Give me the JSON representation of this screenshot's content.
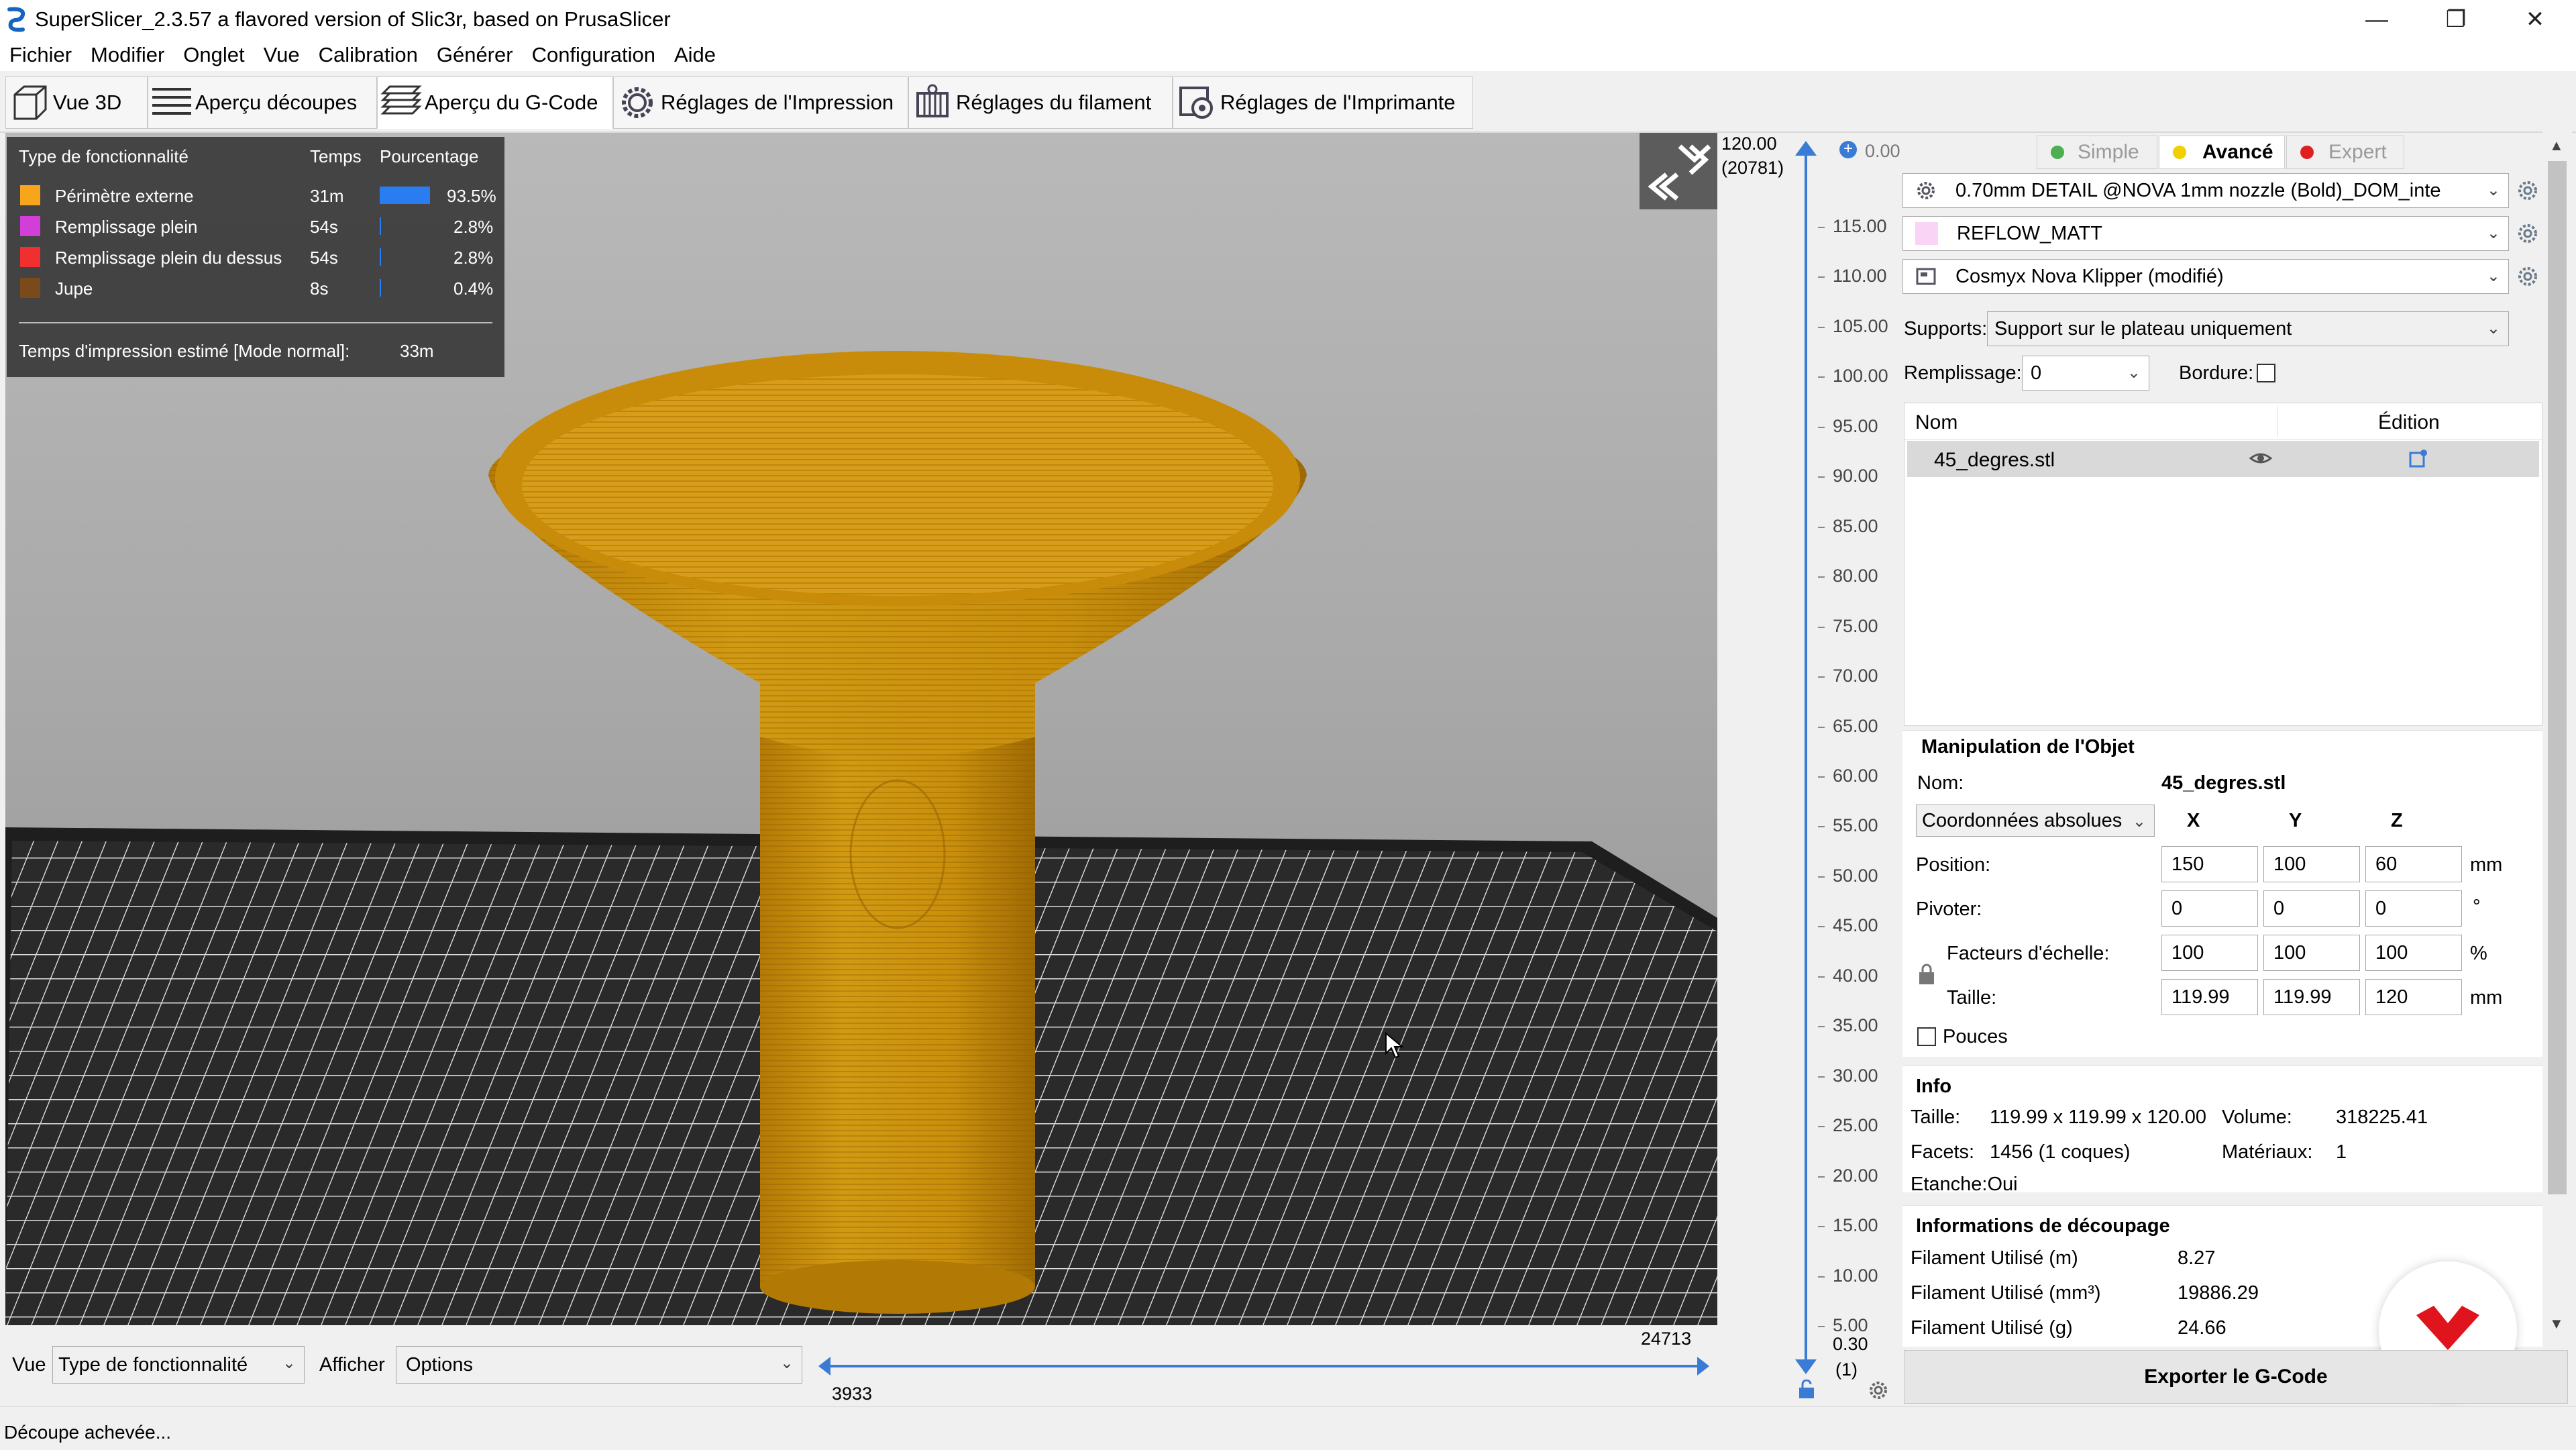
{
  "window": {
    "title": "SuperSlicer_2.3.57 a flavored version of Slic3r, based on PrusaSlicer",
    "minimize": "—",
    "maximize": "❐",
    "close": "✕"
  },
  "menu": [
    "Fichier",
    "Modifier",
    "Onglet",
    "Vue",
    "Calibration",
    "Générer",
    "Configuration",
    "Aide"
  ],
  "tabs": [
    {
      "label": "Vue 3D"
    },
    {
      "label": "Aperçu découpes"
    },
    {
      "label": "Aperçu du G-Code"
    },
    {
      "label": "Réglages de l'Impression"
    },
    {
      "label": "Réglages du filament"
    },
    {
      "label": "Réglages de l'Imprimante"
    }
  ],
  "legend": {
    "headers": {
      "type": "Type de fonctionnalité",
      "time": "Temps",
      "pct": "Pourcentage"
    },
    "rows": [
      {
        "name": "Périmètre externe",
        "time": "31m",
        "pct": "93.5%",
        "color": "#f7a51b",
        "fraction": 0.935
      },
      {
        "name": "Remplissage plein",
        "time": "54s",
        "pct": "2.8%",
        "color": "#d23fd8",
        "fraction": 0.028
      },
      {
        "name": "Remplissage plein du dessus",
        "time": "54s",
        "pct": "2.8%",
        "color": "#f03030",
        "fraction": 0.028
      },
      {
        "name": "Jupe",
        "time": "8s",
        "pct": "0.4%",
        "color": "#7a4a1a",
        "fraction": 0.004
      }
    ],
    "estimate_label": "Temps d'impression estimé [Mode normal]:",
    "estimate_value": "33m"
  },
  "vslider": {
    "top_value": "120.00",
    "top_layer": "(20781)",
    "top_extra": "0.00",
    "bottom_value": "0.30",
    "bottom_layer": "(1)",
    "ticks": [
      "115.00",
      "110.00",
      "105.00",
      "100.00",
      "95.00",
      "90.00",
      "85.00",
      "80.00",
      "75.00",
      "70.00",
      "65.00",
      "60.00",
      "55.00",
      "50.00",
      "45.00",
      "40.00",
      "35.00",
      "30.00",
      "25.00",
      "20.00",
      "15.00",
      "10.00",
      "5.00"
    ]
  },
  "hslider": {
    "right_value": "24713",
    "left_value": "3933"
  },
  "bottom": {
    "vue_label": "Vue",
    "vue_value": "Type de fonctionnalité",
    "afficher_label": "Afficher",
    "afficher_value": "Options"
  },
  "modes": {
    "simple": "Simple",
    "advanced": "Avancé",
    "expert": "Expert",
    "simple_color": "#4caf50",
    "advanced_color": "#f0d000",
    "expert_color": "#e02020"
  },
  "presets": {
    "print": "0.70mm DETAIL @NOVA 1mm nozzle (Bold)_DOM_inte",
    "filament": "REFLOW_MATT",
    "printer": "Cosmyx Nova Klipper (modifié)",
    "filament_color": "#f9d4f4"
  },
  "supports": {
    "label": "Supports:",
    "value": "Support sur le plateau uniquement"
  },
  "infill": {
    "label": "Remplissage:",
    "value": "0"
  },
  "brim": {
    "label": "Bordure:"
  },
  "object_list": {
    "headers": {
      "name": "Nom",
      "edit": "Édition"
    },
    "items": [
      {
        "name": "45_degres.stl"
      }
    ]
  },
  "manipulation": {
    "title": "Manipulation de l'Objet",
    "name_label": "Nom:",
    "name_value": "45_degres.stl",
    "coords": "Coordonnées absolues",
    "axes": [
      "X",
      "Y",
      "Z"
    ],
    "position_label": "Position:",
    "position": [
      "150",
      "100",
      "60"
    ],
    "position_unit": "mm",
    "rotate_label": "Pivoter:",
    "rotate": [
      "0",
      "0",
      "0"
    ],
    "rotate_unit": "°",
    "scale_label": "Facteurs d'échelle:",
    "scale": [
      "100",
      "100",
      "100"
    ],
    "scale_unit": "%",
    "size_label": "Taille:",
    "size": [
      "119.99",
      "119.99",
      "120"
    ],
    "size_unit": "mm",
    "inches_label": "Pouces"
  },
  "info": {
    "title": "Info",
    "size_label": "Taille:",
    "size_value": "119.99 x 119.99 x 120.00",
    "volume_label": "Volume:",
    "volume_value": "318225.41",
    "facets_label": "Facets:",
    "facets_value": "1456 (1 coques)",
    "materials_label": "Matériaux:",
    "materials_value": "1",
    "watertight": "Etanche:Oui"
  },
  "slice_info": {
    "title": "Informations de découpage",
    "rows": [
      {
        "label": "Filament Utilisé (m)",
        "value": "8.27"
      },
      {
        "label": "Filament Utilisé (mm³)",
        "value": "19886.29"
      },
      {
        "label": "Filament Utilisé (g)",
        "value": "24.66"
      }
    ]
  },
  "export_button": "Exporter le G-Code",
  "status": "Découpe achevée..."
}
